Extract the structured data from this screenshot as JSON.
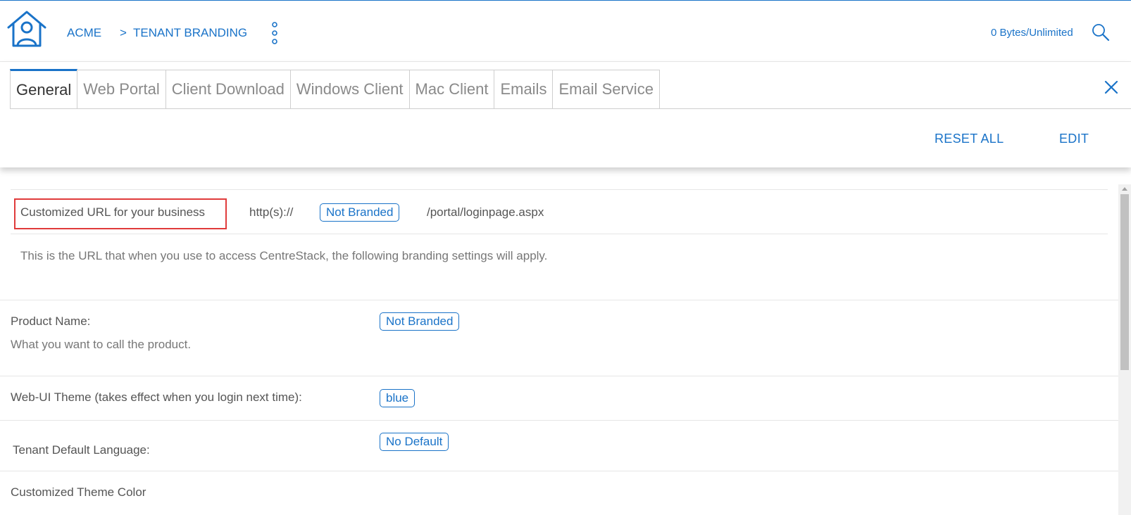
{
  "header": {
    "breadcrumb_root": "ACME",
    "breadcrumb_separator": ">",
    "breadcrumb_current": "TENANT BRANDING",
    "storage": "0 Bytes/Unlimited",
    "icons": {
      "home": "home-user-icon",
      "menu": "kebab-menu-icon",
      "search": "search-icon"
    }
  },
  "tabs": [
    {
      "label": "General",
      "active": true
    },
    {
      "label": "Web Portal",
      "active": false
    },
    {
      "label": "Client Download",
      "active": false
    },
    {
      "label": "Windows Client",
      "active": false
    },
    {
      "label": "Mac Client",
      "active": false
    },
    {
      "label": "Emails",
      "active": false
    },
    {
      "label": "Email Service",
      "active": false
    }
  ],
  "actions": {
    "reset_all": "RESET ALL",
    "edit": "EDIT"
  },
  "url_section": {
    "label": "Customized URL for your business",
    "prefix": "http(s)://",
    "value": "Not Branded",
    "suffix": "/portal/loginpage.aspx",
    "description": "This is the URL that when you use to access CentreStack, the following branding settings will apply."
  },
  "settings": {
    "product_name": {
      "label": "Product Name:",
      "description": "What you want to call the product.",
      "value": "Not Branded"
    },
    "web_ui_theme": {
      "label": "Web-UI Theme (takes effect when you login next time):",
      "value": "blue"
    },
    "default_language": {
      "label": "Tenant Default Language:",
      "value": "No Default"
    },
    "theme_color": {
      "label": "Customized Theme Color"
    }
  },
  "colors": {
    "accent": "#1a73c8",
    "highlight": "#e03b3b"
  }
}
